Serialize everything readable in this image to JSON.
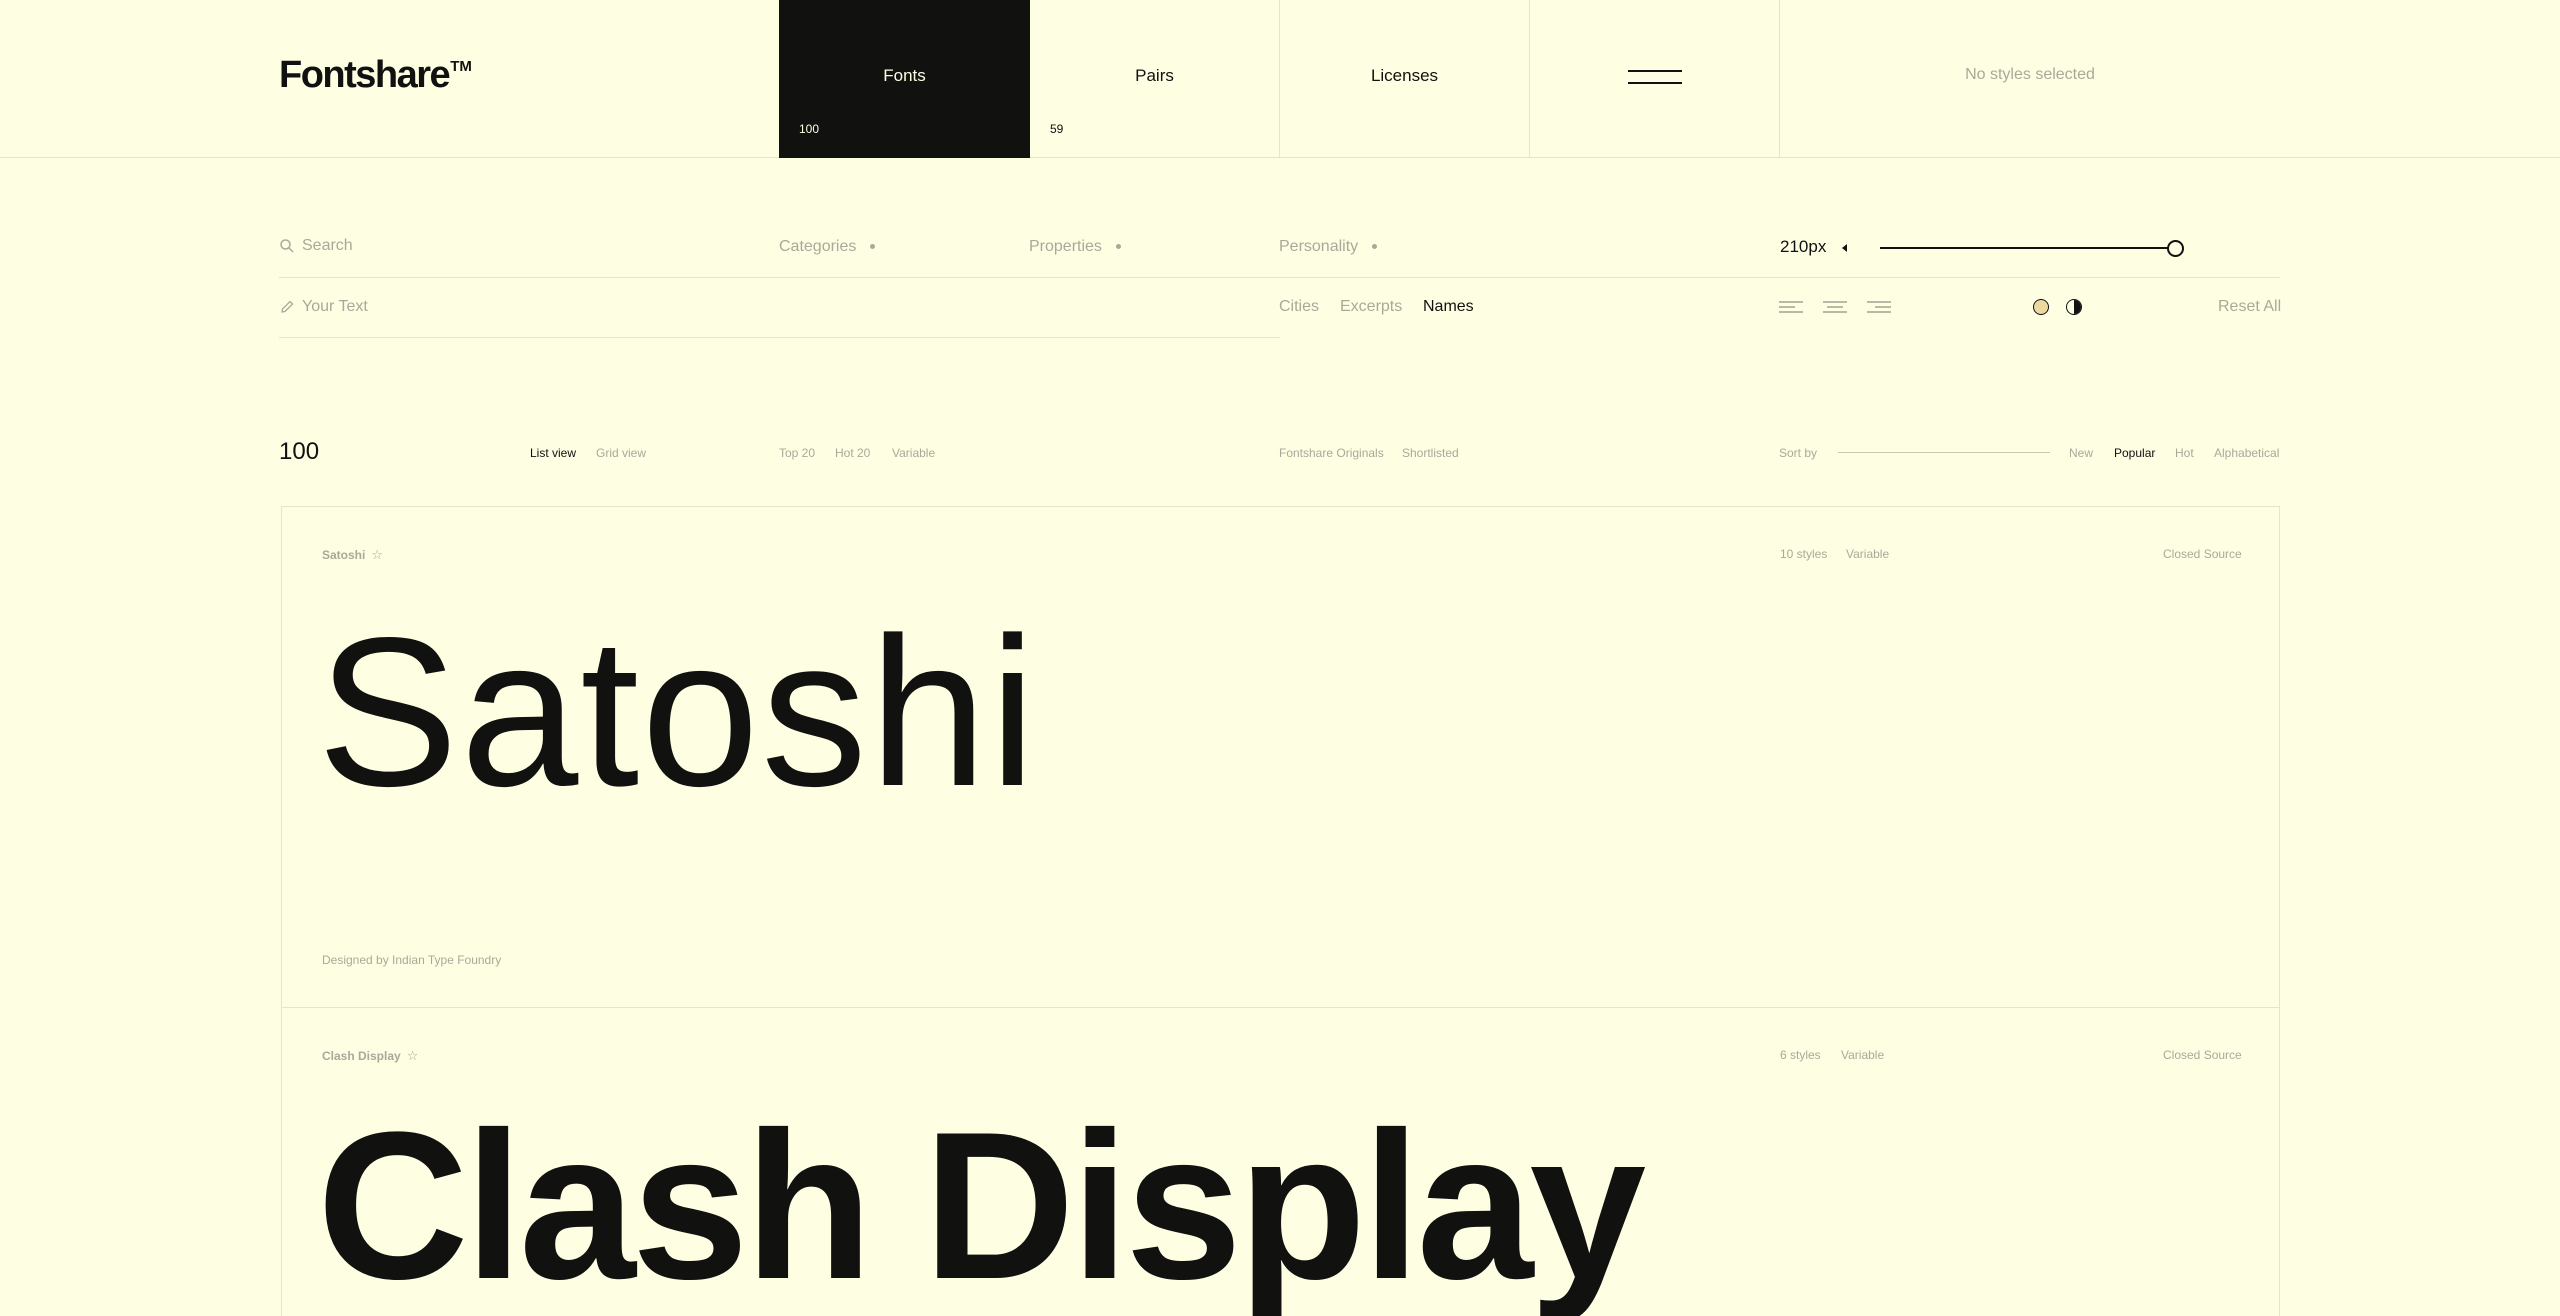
{
  "header": {
    "logo": "Fontshare",
    "logo_tm": "TM",
    "nav": [
      {
        "label": "Fonts",
        "count": "100"
      },
      {
        "label": "Pairs",
        "count": "59"
      },
      {
        "label": "Licenses"
      }
    ],
    "styles_status": "No styles selected"
  },
  "filters": {
    "search_placeholder": "Search",
    "categories": "Categories",
    "properties": "Properties",
    "personality": "Personality",
    "size": "210px",
    "size_slider_fraction": 1.0,
    "text_placeholder": "Your Text",
    "text_tabs": [
      "Cities",
      "Excerpts",
      "Names"
    ],
    "text_tab_active": "Names",
    "reset": "Reset All"
  },
  "listing": {
    "count": "100",
    "views": [
      "List view",
      "Grid view"
    ],
    "active_view": "List view",
    "quick_filters": [
      "Top 20",
      "Hot 20",
      "Variable"
    ],
    "collections": [
      "Fontshare Originals",
      "Shortlisted"
    ],
    "sort_label": "Sort by",
    "sort_options": [
      "New",
      "Popular",
      "Hot",
      "Alphabetical"
    ],
    "active_sort": "Popular"
  },
  "fonts": [
    {
      "name": "Satoshi",
      "styles": "10 styles",
      "variable": "Variable",
      "license": "Closed Source",
      "specimen": "Satoshi",
      "designer": "Designed by Indian Type Foundry"
    },
    {
      "name": "Clash Display",
      "styles": "6 styles",
      "variable": "Variable",
      "license": "Closed Source",
      "specimen": "Clash Display"
    }
  ],
  "colors": {
    "background": "#fefee3",
    "ink": "#111110",
    "muted": "#a9a99a",
    "rule": "#e5e5c8"
  }
}
